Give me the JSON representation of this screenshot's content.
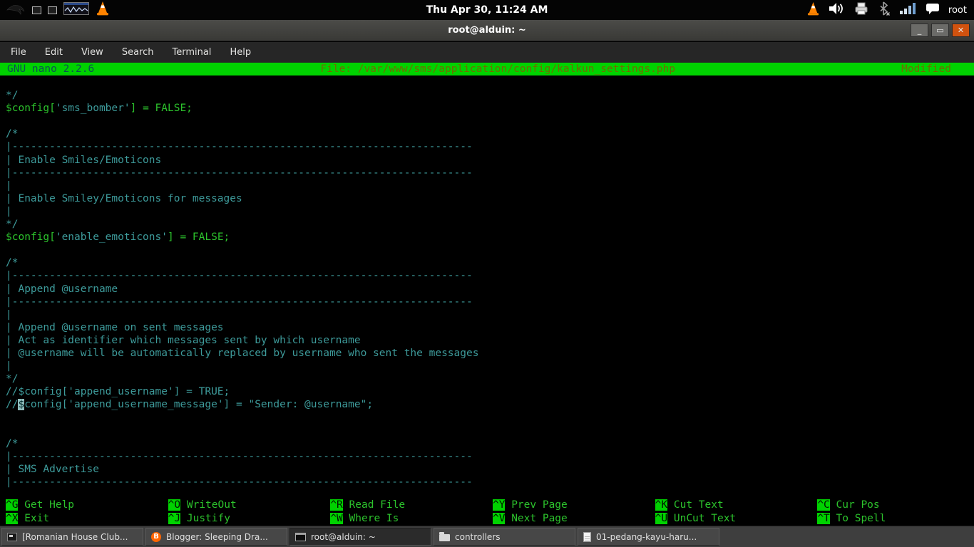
{
  "panel": {
    "clock": "Thu Apr 30, 11:24 AM",
    "user": "root"
  },
  "window": {
    "title": "root@alduin: ~",
    "menu": [
      "File",
      "Edit",
      "View",
      "Search",
      "Terminal",
      "Help"
    ]
  },
  "nano": {
    "version": "GNU nano 2.2.6",
    "file": "File: /var/www/sms/application/config/kalkun_settings.php",
    "modified": "Modified",
    "dash_line": "|--------------------------------------------------------------------------",
    "lines": [
      [],
      [
        {
          "t": "*/",
          "c": "c"
        }
      ],
      [
        {
          "t": "$config[",
          "c": "g"
        },
        {
          "t": "'sms_bomber'",
          "c": "c"
        },
        {
          "t": "] = FALSE;",
          "c": "g"
        }
      ],
      [],
      [
        {
          "t": "/*",
          "c": "c"
        }
      ],
      [
        {
          "ref": "dash_line",
          "c": "c"
        }
      ],
      [
        {
          "t": "| Enable Smiles/Emoticons",
          "c": "c"
        }
      ],
      [
        {
          "ref": "dash_line",
          "c": "c"
        }
      ],
      [
        {
          "t": "|",
          "c": "c"
        }
      ],
      [
        {
          "t": "| Enable Smiley/Emoticons for messages",
          "c": "c"
        }
      ],
      [
        {
          "t": "|",
          "c": "c"
        }
      ],
      [
        {
          "t": "*/",
          "c": "c"
        }
      ],
      [
        {
          "t": "$config[",
          "c": "g"
        },
        {
          "t": "'enable_emoticons'",
          "c": "c"
        },
        {
          "t": "] = FALSE;",
          "c": "g"
        }
      ],
      [],
      [
        {
          "t": "/*",
          "c": "c"
        }
      ],
      [
        {
          "ref": "dash_line",
          "c": "c"
        }
      ],
      [
        {
          "t": "| Append @username",
          "c": "c"
        }
      ],
      [
        {
          "ref": "dash_line",
          "c": "c"
        }
      ],
      [
        {
          "t": "|",
          "c": "c"
        }
      ],
      [
        {
          "t": "| Append @username on sent messages",
          "c": "c"
        }
      ],
      [
        {
          "t": "| Act as identifier which messages sent by which username",
          "c": "c"
        }
      ],
      [
        {
          "t": "| @username will be automatically replaced by username who sent the messages",
          "c": "c"
        }
      ],
      [
        {
          "t": "|",
          "c": "c"
        }
      ],
      [
        {
          "t": "*/",
          "c": "c"
        }
      ],
      [
        {
          "t": "//$config['append_username'] = TRUE;",
          "c": "c"
        }
      ],
      [
        {
          "t": "//",
          "c": "c"
        },
        {
          "t": "$",
          "c": "cur"
        },
        {
          "t": "config['append_username_message'] = \"Sender: @username\";",
          "c": "c"
        }
      ],
      [],
      [],
      [
        {
          "t": "/*",
          "c": "c"
        }
      ],
      [
        {
          "ref": "dash_line",
          "c": "c"
        }
      ],
      [
        {
          "t": "| SMS Advertise",
          "c": "c"
        }
      ],
      [
        {
          "ref": "dash_line",
          "c": "c"
        }
      ]
    ],
    "shortcuts": [
      [
        {
          "key": "^G",
          "label": "Get Help"
        },
        {
          "key": "^O",
          "label": "WriteOut"
        },
        {
          "key": "^R",
          "label": "Read File"
        },
        {
          "key": "^Y",
          "label": "Prev Page"
        },
        {
          "key": "^K",
          "label": "Cut Text"
        },
        {
          "key": "^C",
          "label": "Cur Pos"
        }
      ],
      [
        {
          "key": "^X",
          "label": "Exit"
        },
        {
          "key": "^J",
          "label": "Justify"
        },
        {
          "key": "^W",
          "label": "Where Is"
        },
        {
          "key": "^V",
          "label": "Next Page"
        },
        {
          "key": "^U",
          "label": "UnCut Text"
        },
        {
          "key": "^T",
          "label": "To Spell"
        }
      ]
    ]
  },
  "taskbar": {
    "items": [
      {
        "label": "[Romanian House Club...",
        "icon": "media-app-icon",
        "active": false
      },
      {
        "label": "Blogger: Sleeping Dra...",
        "icon": "blogger-icon",
        "active": false
      },
      {
        "label": "root@alduin: ~",
        "icon": "terminal-icon",
        "active": true
      },
      {
        "label": "controllers",
        "icon": "folder-icon",
        "active": false
      },
      {
        "label": "01-pedang-kayu-haru...",
        "icon": "document-icon",
        "active": false
      }
    ]
  }
}
